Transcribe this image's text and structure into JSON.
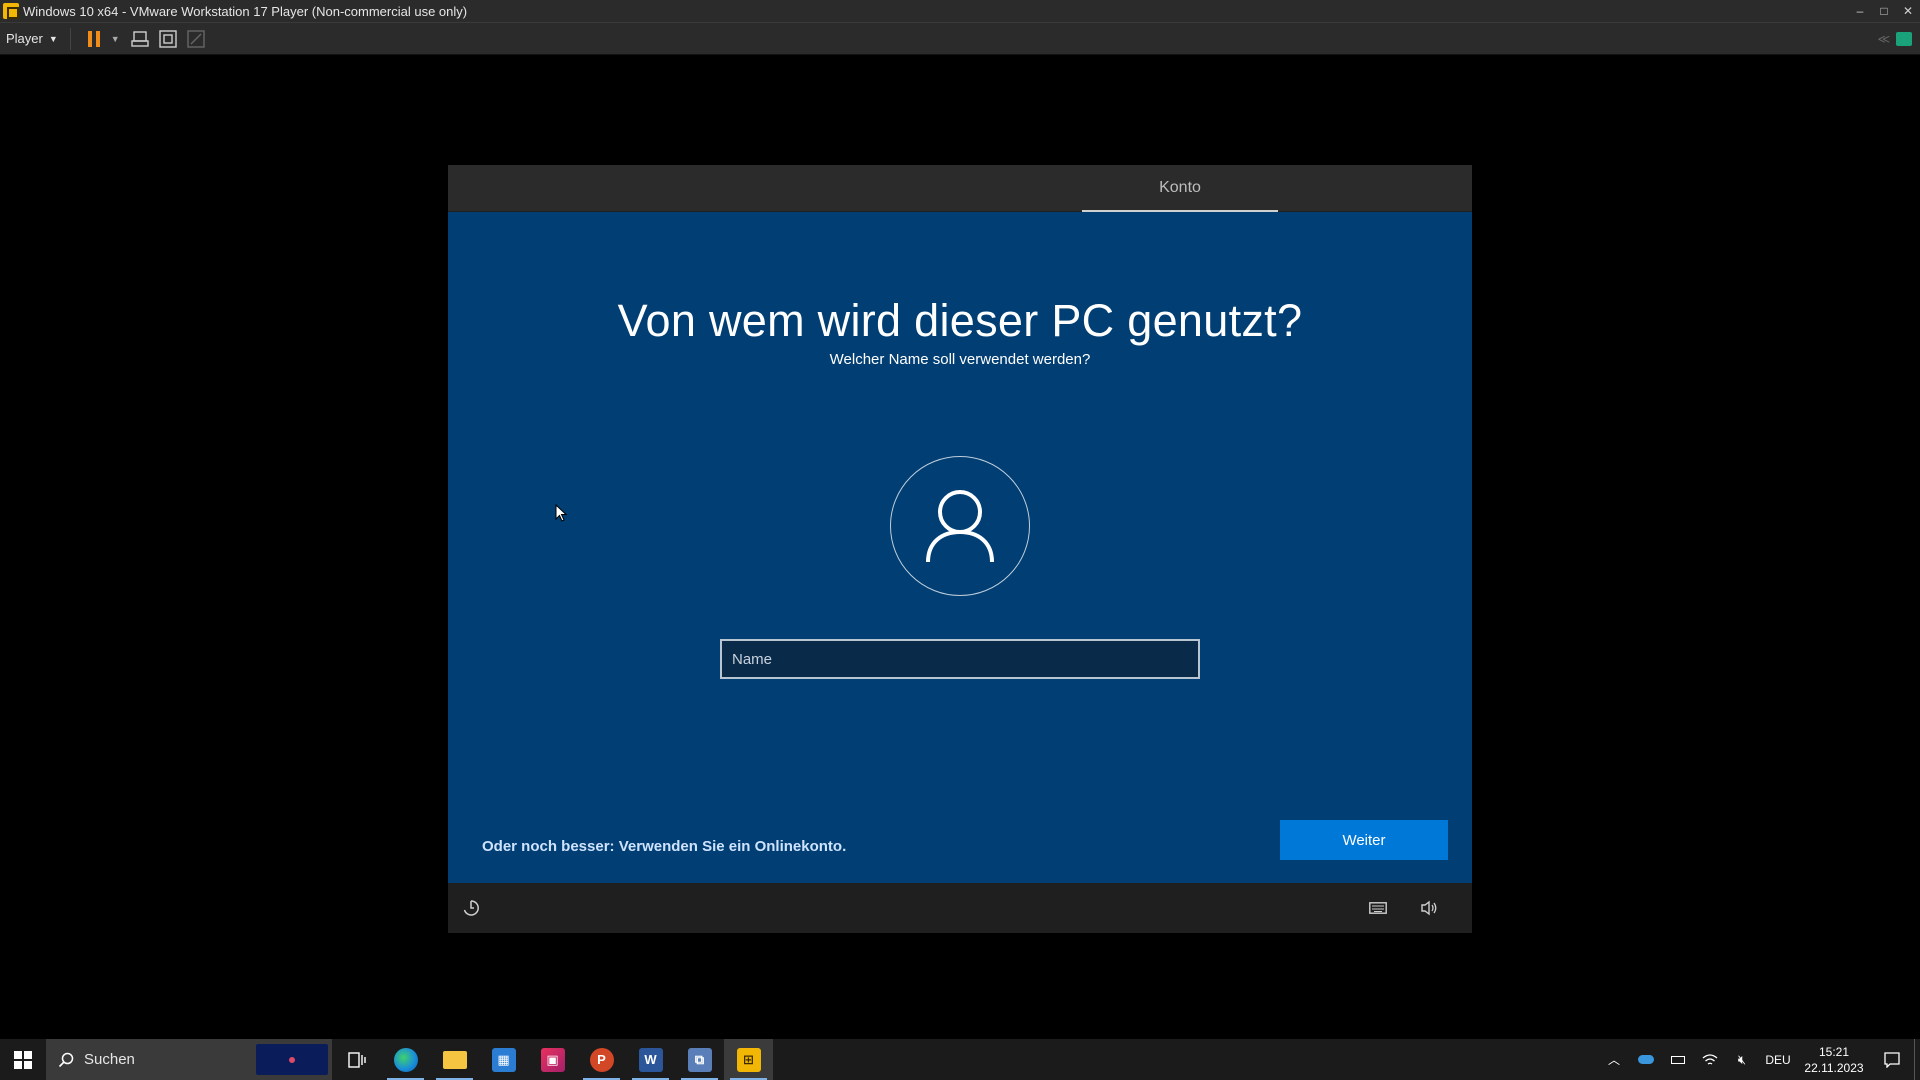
{
  "window": {
    "title": "Windows 10 x64 - VMware Workstation 17 Player (Non-commercial use only)",
    "minimize": "–",
    "maximize": "□",
    "close": "✕"
  },
  "toolbar": {
    "player_label": "Player",
    "icons": [
      "pause-icon",
      "send-ctrl-alt-del-icon",
      "fullscreen-icon",
      "unity-icon"
    ]
  },
  "oobe": {
    "tab_label": "Konto",
    "title": "Von wem wird dieser PC genutzt?",
    "subtitle": "Welcher Name soll verwendet werden?",
    "name_placeholder": "Name",
    "name_value": "",
    "online_link": "Oder noch besser: Verwenden Sie ein Onlinekonto.",
    "next_button": "Weiter",
    "background_color": "#003e73",
    "accent_color": "#0078d7"
  },
  "taskbar": {
    "search_placeholder": "Suchen",
    "apps": [
      "task-view",
      "edge",
      "file-explorer",
      "microsoft-store",
      "jetbrains",
      "powerpoint",
      "word",
      "remote-desktop",
      "vmware-player"
    ],
    "tray": {
      "language": "DEU",
      "time": "15:21",
      "date": "22.11.2023"
    }
  }
}
